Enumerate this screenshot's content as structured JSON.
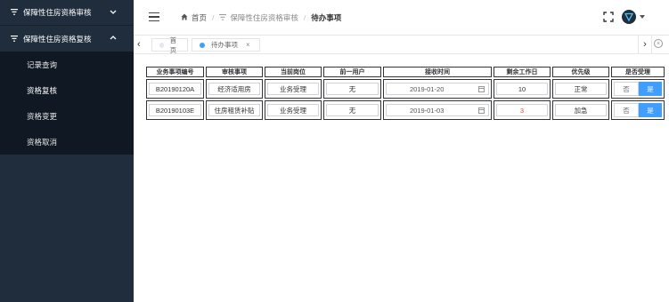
{
  "sidebar": {
    "group1_title": "保障性住房资格审核",
    "group2_title": "保障性住房资格复核",
    "items": [
      {
        "label": "记录查询"
      },
      {
        "label": "资格复核"
      },
      {
        "label": "资格变更"
      },
      {
        "label": "资格取消"
      }
    ],
    "active_item": "资格复核"
  },
  "header": {
    "breadcrumb": {
      "home": "首页",
      "parent": "保障性住房资格审核",
      "current": "待办事项"
    }
  },
  "tabs": [
    {
      "label": "首页",
      "active": false
    },
    {
      "label": "待办事项",
      "active": true
    }
  ],
  "table": {
    "headers": [
      "业务事项编号",
      "审核事项",
      "当前岗位",
      "前一用户",
      "接收时间",
      "剩余工作日",
      "优先级",
      "是否受理"
    ],
    "rows": [
      {
        "id": "B20190120A",
        "item": "经济适用房",
        "post": "业务受理",
        "prev_user": "无",
        "received": "2019-01-20",
        "remaining": "10",
        "priority": "正常",
        "no": "否",
        "yes": "是"
      },
      {
        "id": "B20190103E",
        "item": "住房租赁补贴",
        "post": "业务受理",
        "prev_user": "无",
        "received": "2019-01-03",
        "remaining": "3",
        "priority": "加急",
        "no": "否",
        "yes": "是"
      }
    ]
  },
  "colors": {
    "sidebar_bg": "#1f2d3d",
    "submenu_bg": "#101923",
    "accent": "#409eff",
    "warning_text": "#e64340"
  }
}
